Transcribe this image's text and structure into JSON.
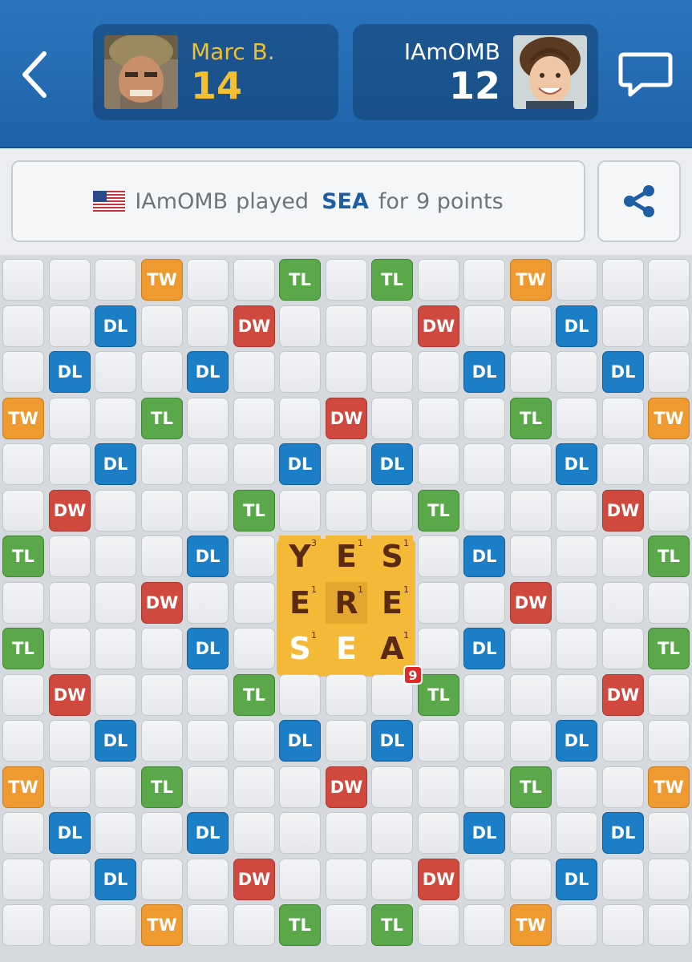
{
  "header": {
    "back_icon": "chevron-left-icon",
    "chat_icon": "chat-bubble-icon",
    "player1": {
      "name": "Marc B.",
      "score": "14",
      "color": "#f3bf32"
    },
    "player2": {
      "name": "IAmOMB",
      "score": "12",
      "color": "#ffffff"
    }
  },
  "status": {
    "flag_icon": "us-flag-icon",
    "player": "IAmOMB",
    "verb": "played",
    "word": "SEA",
    "for_text": "for",
    "points_text": "9 points",
    "share_icon": "share-icon"
  },
  "board": {
    "rows": [
      [
        "",
        "",
        "",
        "TW",
        "",
        "",
        "TL",
        "",
        "TL",
        "",
        "",
        "TW",
        "",
        "",
        ""
      ],
      [
        "",
        "",
        "DL",
        "",
        "",
        "DW",
        "",
        "",
        "",
        "DW",
        "",
        "",
        "DL",
        "",
        ""
      ],
      [
        "",
        "DL",
        "",
        "",
        "DL",
        "",
        "",
        "",
        "",
        "",
        "DL",
        "",
        "",
        "DL",
        ""
      ],
      [
        "TW",
        "",
        "",
        "TL",
        "",
        "",
        "",
        "DW",
        "",
        "",
        "",
        "TL",
        "",
        "",
        "TW"
      ],
      [
        "",
        "",
        "DL",
        "",
        "",
        "",
        "DL",
        "",
        "DL",
        "",
        "",
        "",
        "DL",
        "",
        ""
      ],
      [
        "",
        "DW",
        "",
        "",
        "",
        "TL",
        "",
        "",
        "",
        "TL",
        "",
        "",
        "",
        "DW",
        ""
      ],
      [
        "TL",
        "",
        "",
        "",
        "DL",
        "",
        "",
        "",
        "",
        "",
        "DL",
        "",
        "",
        "",
        "TL"
      ],
      [
        "",
        "",
        "",
        "DW",
        "",
        "",
        "",
        "",
        "",
        "",
        "",
        "DW",
        "",
        "",
        ""
      ],
      [
        "TL",
        "",
        "",
        "",
        "DL",
        "",
        "",
        "",
        "",
        "",
        "DL",
        "",
        "",
        "",
        "TL"
      ],
      [
        "",
        "DW",
        "",
        "",
        "",
        "TL",
        "",
        "",
        "",
        "TL",
        "",
        "",
        "",
        "DW",
        ""
      ],
      [
        "",
        "",
        "DL",
        "",
        "",
        "",
        "DL",
        "",
        "DL",
        "",
        "",
        "",
        "DL",
        "",
        ""
      ],
      [
        "TW",
        "",
        "",
        "TL",
        "",
        "",
        "",
        "DW",
        "",
        "",
        "",
        "TL",
        "",
        "",
        "TW"
      ],
      [
        "",
        "DL",
        "",
        "",
        "DL",
        "",
        "",
        "",
        "",
        "",
        "DL",
        "",
        "",
        "DL",
        ""
      ],
      [
        "",
        "",
        "DL",
        "",
        "",
        "DW",
        "",
        "",
        "",
        "DW",
        "",
        "",
        "DL",
        "",
        ""
      ],
      [
        "",
        "",
        "",
        "TW",
        "",
        "",
        "TL",
        "",
        "TL",
        "",
        "",
        "TW",
        "",
        "",
        ""
      ]
    ],
    "tiles": [
      {
        "row": 6,
        "col": 6,
        "letter": "Y",
        "points": "3",
        "recent": false
      },
      {
        "row": 6,
        "col": 7,
        "letter": "E",
        "points": "1",
        "recent": false
      },
      {
        "row": 6,
        "col": 8,
        "letter": "S",
        "points": "1",
        "recent": false
      },
      {
        "row": 7,
        "col": 6,
        "letter": "E",
        "points": "1",
        "recent": false
      },
      {
        "row": 7,
        "col": 7,
        "letter": "R",
        "points": "1",
        "recent": false,
        "highlight": true
      },
      {
        "row": 7,
        "col": 8,
        "letter": "E",
        "points": "1",
        "recent": false
      },
      {
        "row": 8,
        "col": 6,
        "letter": "S",
        "points": "1",
        "recent": true
      },
      {
        "row": 8,
        "col": 7,
        "letter": "E",
        "points": "",
        "recent": true
      },
      {
        "row": 8,
        "col": 8,
        "letter": "A",
        "points": "1",
        "recent": false
      }
    ],
    "play_score": "9"
  },
  "colors": {
    "header_bg": "#2a75bd",
    "tile": "#f5b938",
    "TW": "#ef9a31",
    "DW": "#d0493f",
    "TL": "#5aa84a",
    "DL": "#1c7ec6"
  }
}
